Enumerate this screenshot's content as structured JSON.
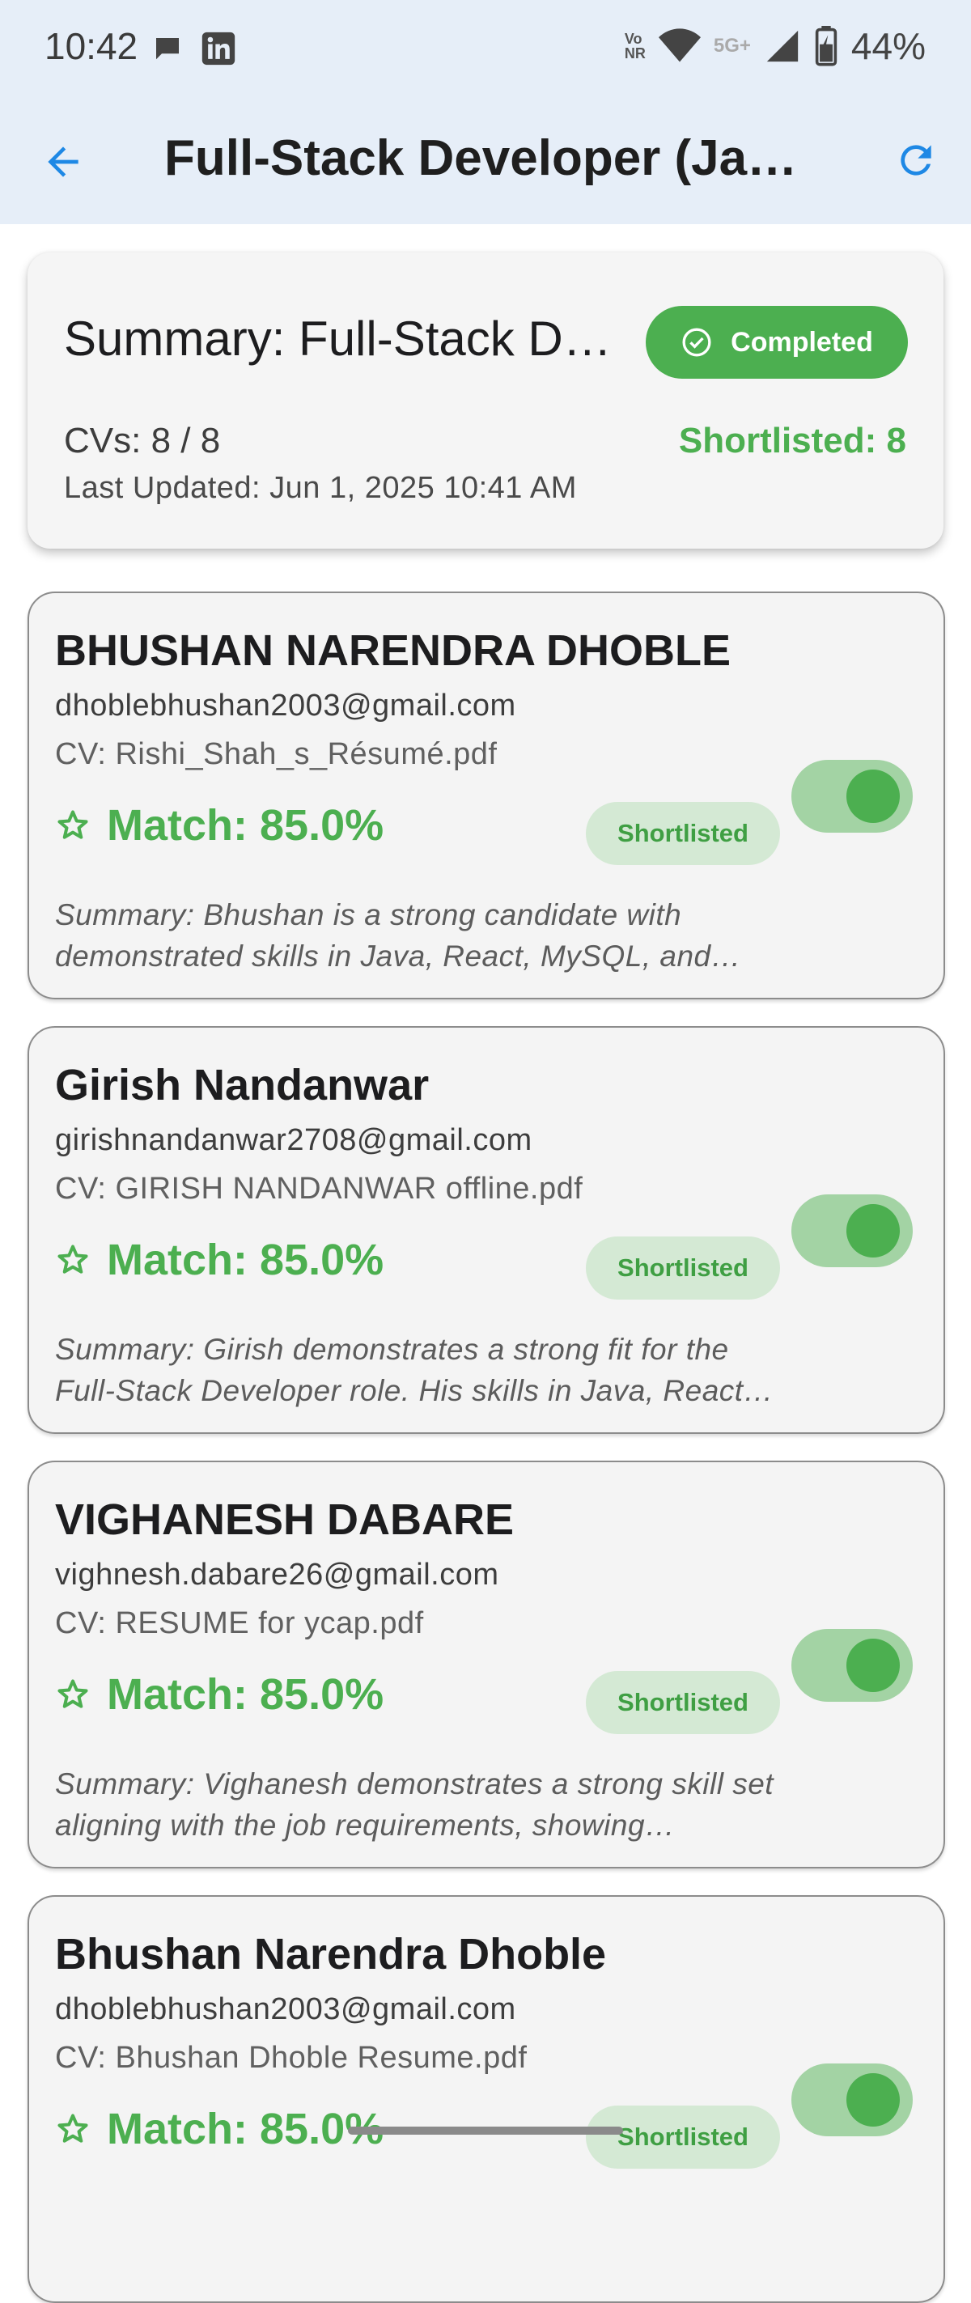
{
  "status_bar": {
    "time": "10:42",
    "network_label": "Vo\nNR",
    "network_5g": "5G+",
    "battery": "44%",
    "icons": [
      "chat-bubble-icon",
      "linkedin-icon",
      "volte-icon",
      "wifi-icon",
      "signal-icon",
      "battery-charging-icon"
    ]
  },
  "app_bar": {
    "title": "Full-Stack Developer (Java, React, MySQL)",
    "back_icon": "arrow-back-icon",
    "refresh_icon": "refresh-icon"
  },
  "summary": {
    "title": "Summary: Full-Stack Developer (Java, React, MySQL)",
    "status": "Completed",
    "cvs": "CVs: 8 / 8",
    "shortlisted": "Shortlisted: 8",
    "last_updated": "Last Updated: Jun 1, 2025 10:41 AM"
  },
  "candidates": [
    {
      "name": "BHUSHAN NARENDRA DHOBLE",
      "email": "dhoblebhushan2003@gmail.com",
      "cv": "CV: Rishi_Shah_s_Résumé.pdf",
      "match": "Match: 85.0%",
      "status": "Shortlisted",
      "shortlisted": true,
      "summary": "Summary: Bhushan is a strong candidate with demonstrated skills in Java, React, MySQL, and other relevant technologies."
    },
    {
      "name": "Girish Nandanwar",
      "email": "girishnandanwar2708@gmail.com",
      "cv": "CV: GIRISH NANDANWAR offline.pdf",
      "match": "Match: 85.0%",
      "status": "Shortlisted",
      "shortlisted": true,
      "summary": "Summary: Girish demonstrates a strong fit for the Full-Stack Developer role. His skills in Java, React and MySQL are well aligned."
    },
    {
      "name": "VIGHANESH DABARE",
      "email": "vighnesh.dabare26@gmail.com",
      "cv": "CV: RESUME for ycap.pdf",
      "match": "Match: 85.0%",
      "status": "Shortlisted",
      "shortlisted": true,
      "summary": "Summary: Vighanesh demonstrates a strong skill set aligning with the job requirements, showing experience across the stack."
    },
    {
      "name": "Bhushan Narendra Dhoble",
      "email": "dhoblebhushan2003@gmail.com",
      "cv": "CV: Bhushan Dhoble Resume.pdf",
      "match": "Match: 85.0%",
      "status": "Shortlisted",
      "shortlisted": true,
      "summary": ""
    }
  ],
  "colors": {
    "accent_green": "#4caf50",
    "chip_green_bg": "#d4e9d4",
    "toggle_track": "#a3d3a4",
    "app_bar_bg": "#e6eef8",
    "link_blue": "#1e88e5"
  }
}
